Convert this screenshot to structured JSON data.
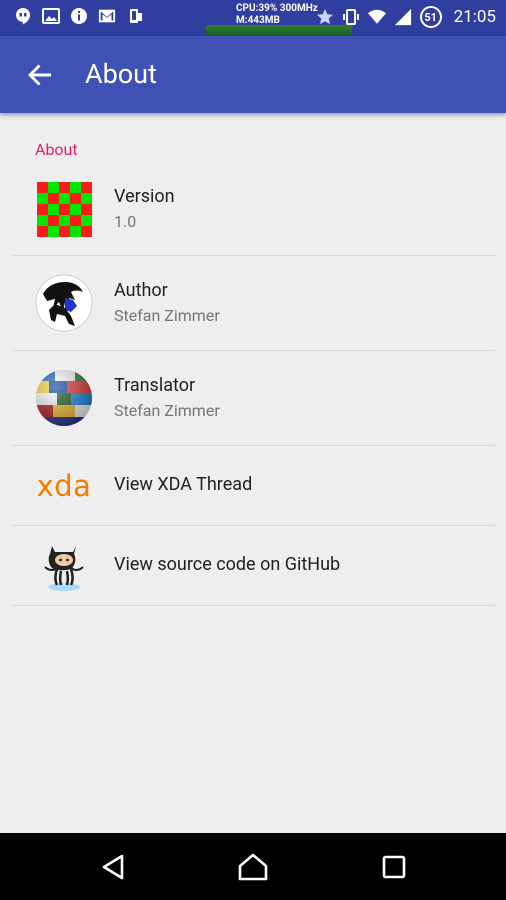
{
  "status_bar": {
    "cpu_line1": "CPU:39% 300MHz",
    "cpu_line2": "M:443MB",
    "notification_count": "51",
    "time": "21:05"
  },
  "app_bar": {
    "title": "About"
  },
  "section": {
    "header": "About"
  },
  "items": [
    {
      "title": "Version",
      "subtitle": "1.0",
      "icon": "checkerboard-icon"
    },
    {
      "title": "Author",
      "subtitle": "Stefan Zimmer",
      "icon": "author-avatar"
    },
    {
      "title": "Translator",
      "subtitle": "Stefan Zimmer",
      "icon": "flags-globe-icon"
    },
    {
      "title": "View XDA Thread",
      "icon": "xda-logo",
      "icon_text": "xda"
    },
    {
      "title": "View source code on GitHub",
      "icon": "github-octocat-icon"
    }
  ],
  "colors": {
    "primary": "#3f51b5",
    "primary_dark": "#303f9f",
    "accent": "#e91e63",
    "xda": "#f57c00"
  }
}
